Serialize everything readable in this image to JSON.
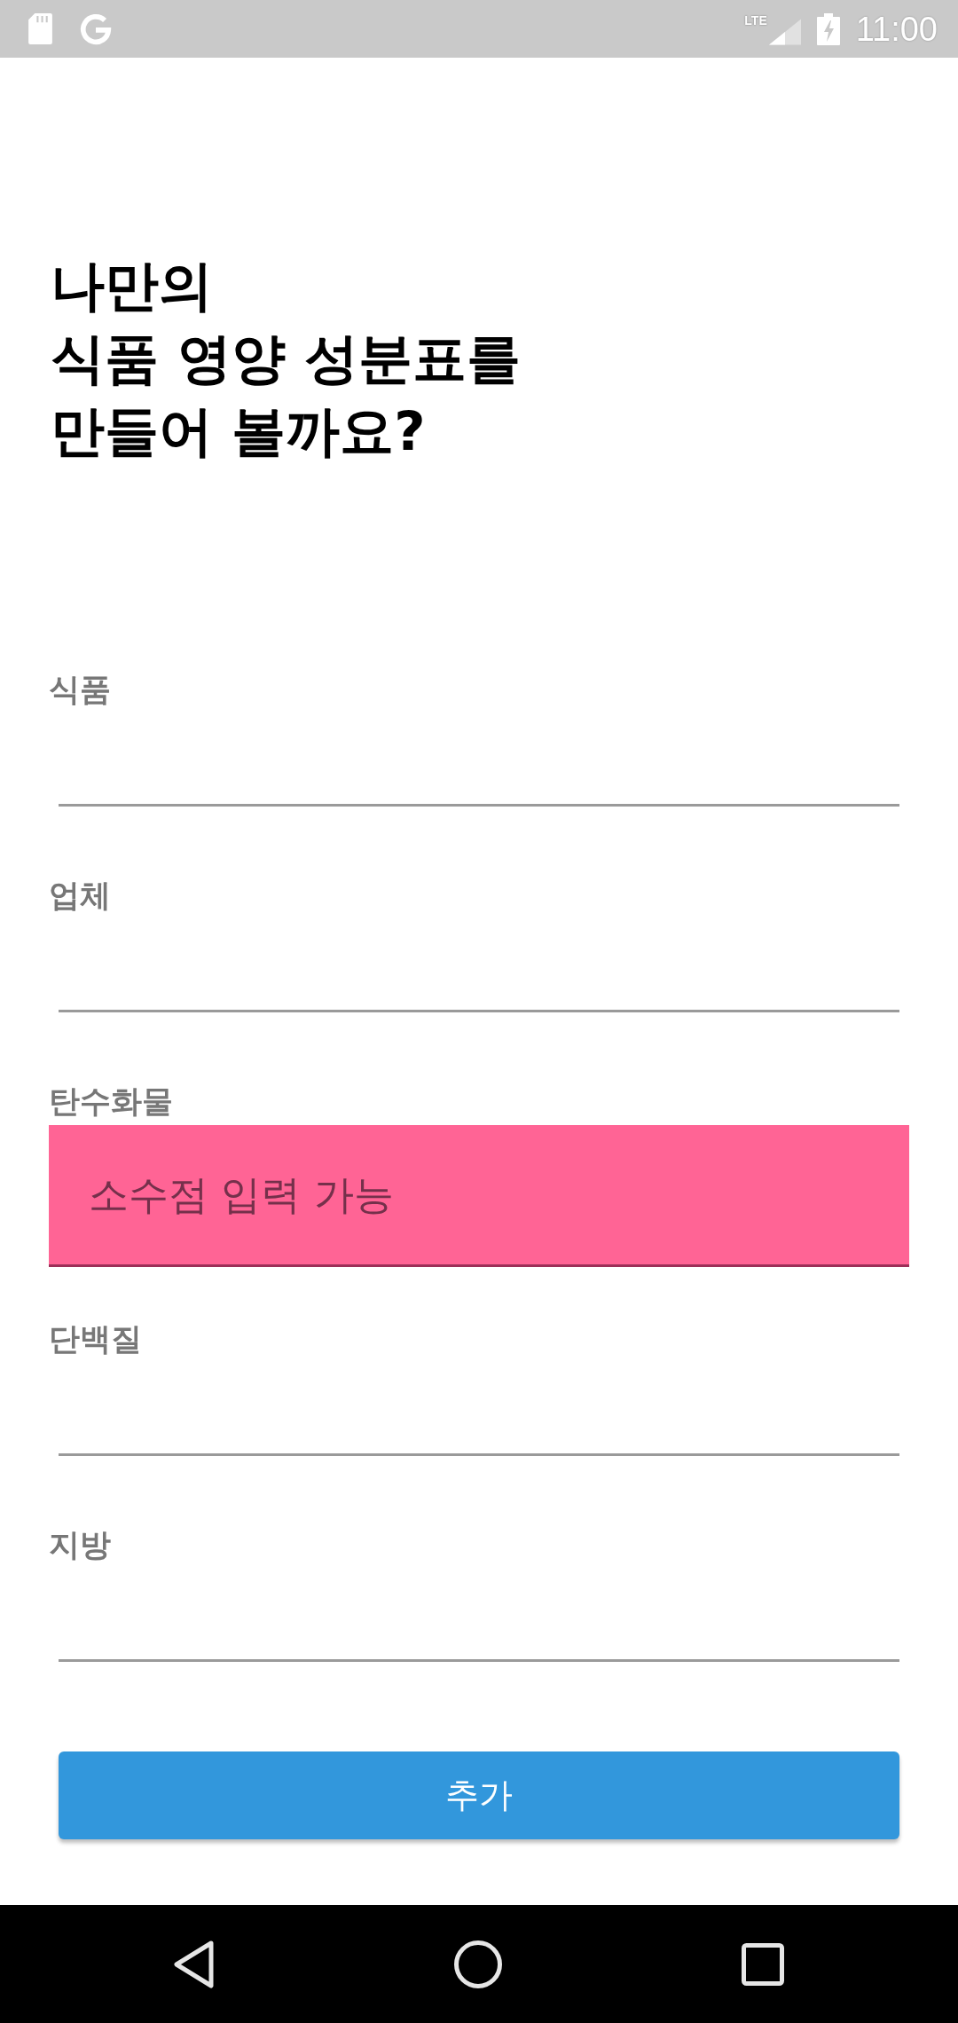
{
  "status_bar": {
    "network_type": "LTE",
    "time": "11:00"
  },
  "title": "나만의\n식품 영양 성분표를\n만들어 볼까요?",
  "fields": [
    {
      "label": "식품"
    },
    {
      "label": "업체"
    },
    {
      "label": "탄수화물",
      "tooltip": "소수점 입력 가능"
    },
    {
      "label": "단백질"
    },
    {
      "label": "지방"
    }
  ],
  "button": {
    "label": "추가"
  }
}
